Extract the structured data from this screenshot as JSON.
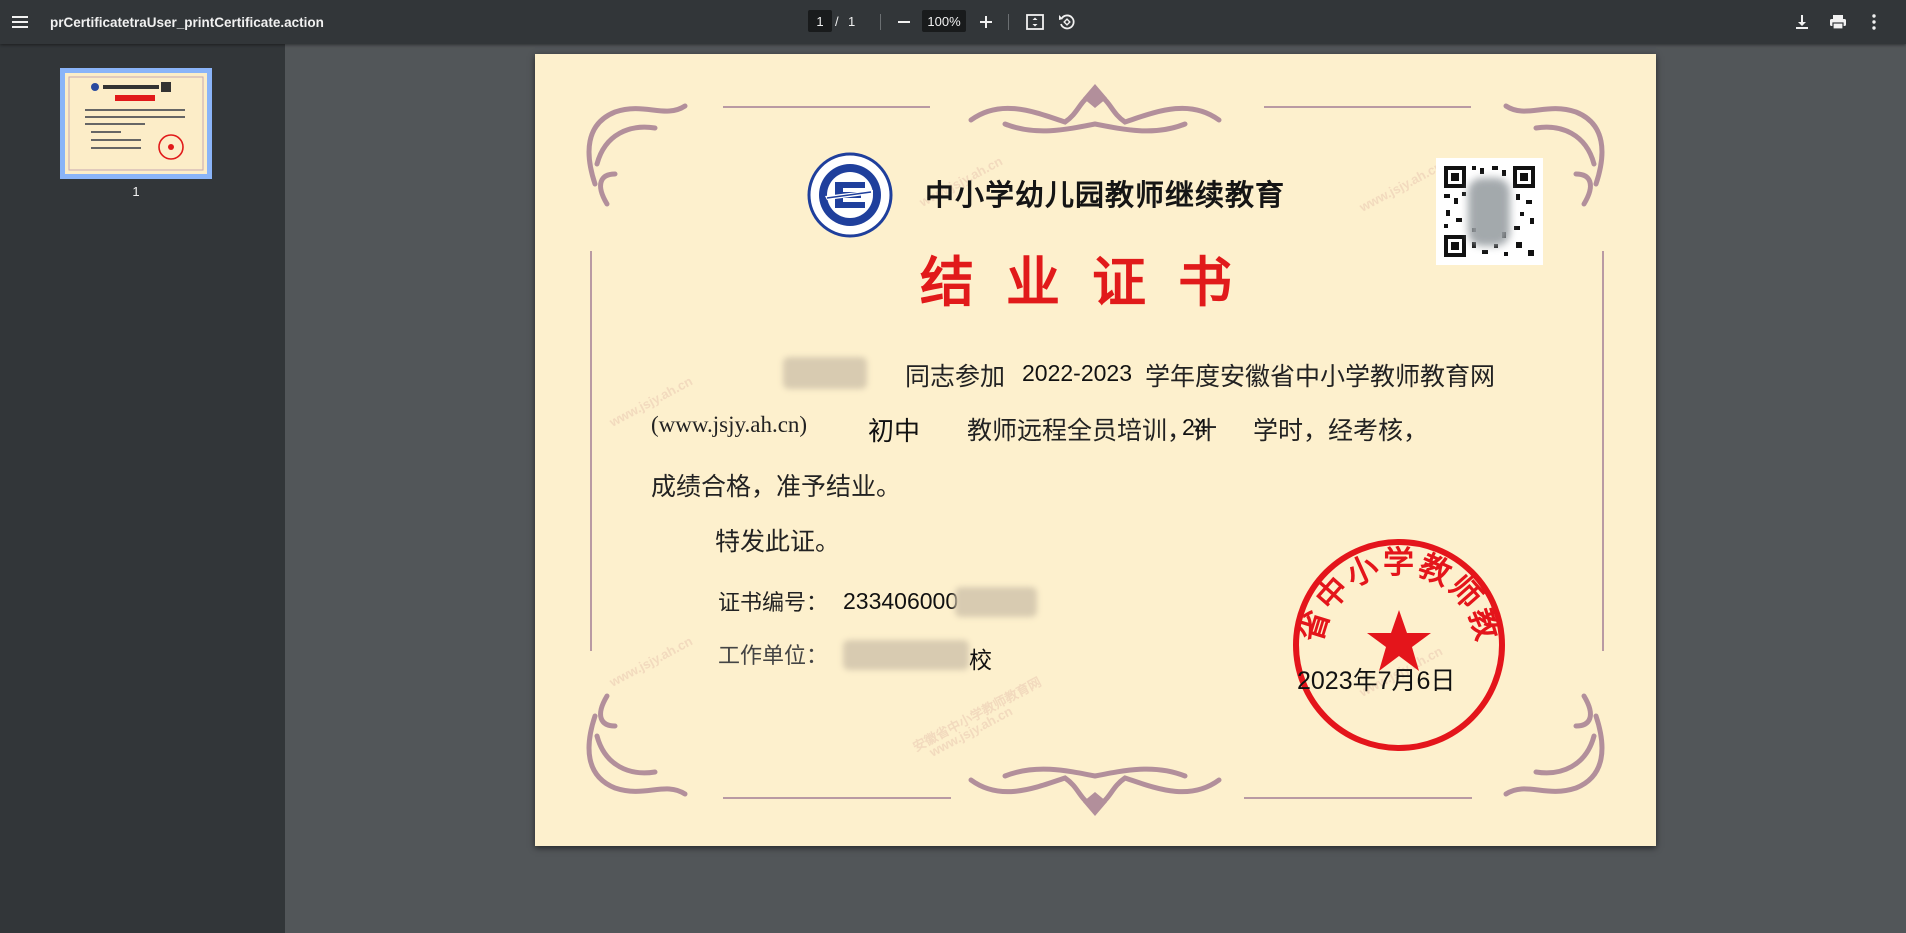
{
  "toolbar": {
    "title": "prCertificatetraUser_printCertificate.action",
    "current_page": "1",
    "page_separator": "/",
    "total_pages": "1",
    "zoom": "100%"
  },
  "sidebar": {
    "thumbnail_label": "1"
  },
  "certificate": {
    "org_title": "中小学幼儿园教师继续教育",
    "cert_title": "结业证书",
    "line1_name_suffix": "",
    "line1_text_a": "同志参加",
    "line1_year": "2022-2023",
    "line1_text_b": "学年度安徽省中小学教师教育网",
    "line2_url": "(www.jsjy.ah.cn)",
    "line2_level": "初中",
    "line2_text_a": "教师远程全员培训，计",
    "line2_hours": "24",
    "line2_text_b": "学时，经考核，",
    "line3_text": "成绩合格，准予结业。",
    "line4_text": "特发此证。",
    "cert_no_label": "证书编号：",
    "cert_no_value": "233406000",
    "work_unit_label": "工作单位：",
    "work_unit_value_suffix": "校",
    "issue_date": "2023年7月6日",
    "logo_text": "安徽省中小学教师教育网",
    "seal_text": "安徽省中小学教师教育网",
    "watermark_text": "安徽省中小学教师教育网",
    "watermark_url": "www.jsjy.ah.cn"
  },
  "colors": {
    "toolbar_bg": "#323639",
    "viewer_bg": "#525659",
    "page_bg": "#fdf0cd",
    "title_red": "#e11a1a",
    "seal_red": "#e4151b",
    "logo_blue": "#1f3f9c",
    "ornament": "#b28f9b"
  },
  "icons": [
    "menu-icon",
    "zoom-out-icon",
    "zoom-in-icon",
    "fit-page-icon",
    "rotate-icon",
    "download-icon",
    "print-icon",
    "more-vert-icon"
  ]
}
